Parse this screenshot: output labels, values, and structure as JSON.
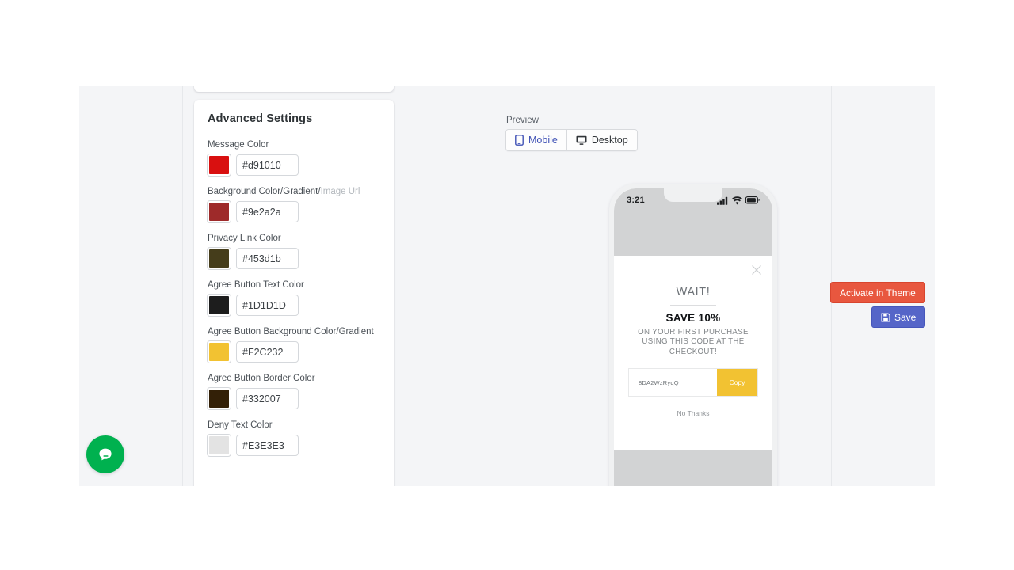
{
  "settings_panel": {
    "title": "Advanced Settings",
    "fields": [
      {
        "label": "Message Color",
        "label_muted": "",
        "value": "#d91010",
        "swatch": "#d91010"
      },
      {
        "label": "Background Color/Gradient/",
        "label_muted": "Image Url",
        "value": "#9e2a2a",
        "swatch": "#9e2a2a"
      },
      {
        "label": "Privacy Link Color",
        "label_muted": "",
        "value": "#453d1b",
        "swatch": "#453d1b"
      },
      {
        "label": "Agree Button Text Color",
        "label_muted": "",
        "value": "#1D1D1D",
        "swatch": "#1D1D1D"
      },
      {
        "label": "Agree Button Background Color/Gradient",
        "label_muted": "",
        "value": "#F2C232",
        "swatch": "#F2C232"
      },
      {
        "label": "Agree Button Border Color",
        "label_muted": "",
        "value": "#332007",
        "swatch": "#332007"
      },
      {
        "label": "Deny Text Color",
        "label_muted": "",
        "value": "#E3E3E3",
        "swatch": "#E3E3E3"
      }
    ]
  },
  "preview": {
    "label": "Preview",
    "toggles": [
      {
        "label": "Mobile",
        "icon": "mobile-phone-icon",
        "active": true
      },
      {
        "label": "Desktop",
        "icon": "desktop-monitor-icon",
        "active": false
      }
    ]
  },
  "phone": {
    "status_bar": {
      "time": "3:21",
      "icons": [
        "cellular-signal-icon",
        "wifi-icon",
        "battery-icon"
      ]
    },
    "popup": {
      "close_icon": "close-icon",
      "heading": "WAIT!",
      "offer": "SAVE 10%",
      "subtext": "ON YOUR FIRST PURCHASE USING THIS CODE AT THE CHECKOUT!",
      "coupon_code": "8DA2WzRyqQ",
      "copy_label": "Copy",
      "deny_label": "No Thanks",
      "copy_button_color": "#f2c232"
    }
  },
  "actions": {
    "activate_label": "Activate in Theme",
    "activate_color": "#e8573f",
    "save_label": "Save",
    "save_icon": "floppy-disk-icon",
    "save_color": "#5565c8"
  },
  "chat_widget": {
    "icon": "chat-bubble-icon",
    "color": "#00b14f"
  }
}
